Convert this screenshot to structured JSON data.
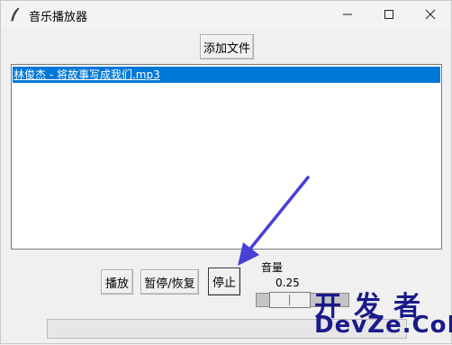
{
  "window": {
    "title": "音乐播放器",
    "controls": [
      "minimize",
      "maximize",
      "close"
    ]
  },
  "toolbar": {
    "add_label": "添加文件"
  },
  "playlist": {
    "items": [
      {
        "label": "林俊杰 - 将故事写成我们.mp3",
        "selected": true
      }
    ]
  },
  "controls": {
    "play_label": "播放",
    "pause_label": "暂停/恢复",
    "stop_label": "停止"
  },
  "volume": {
    "label": "音量",
    "value_text": "0.25",
    "value": 0.25
  },
  "progress": {
    "value": 0
  },
  "watermark": {
    "line1": "开发者",
    "line2": "DevZe.CoM"
  },
  "colors": {
    "selection": "#0078d7",
    "annotation_arrow": "#4a3fd6",
    "watermark": "#1a1a8c"
  }
}
